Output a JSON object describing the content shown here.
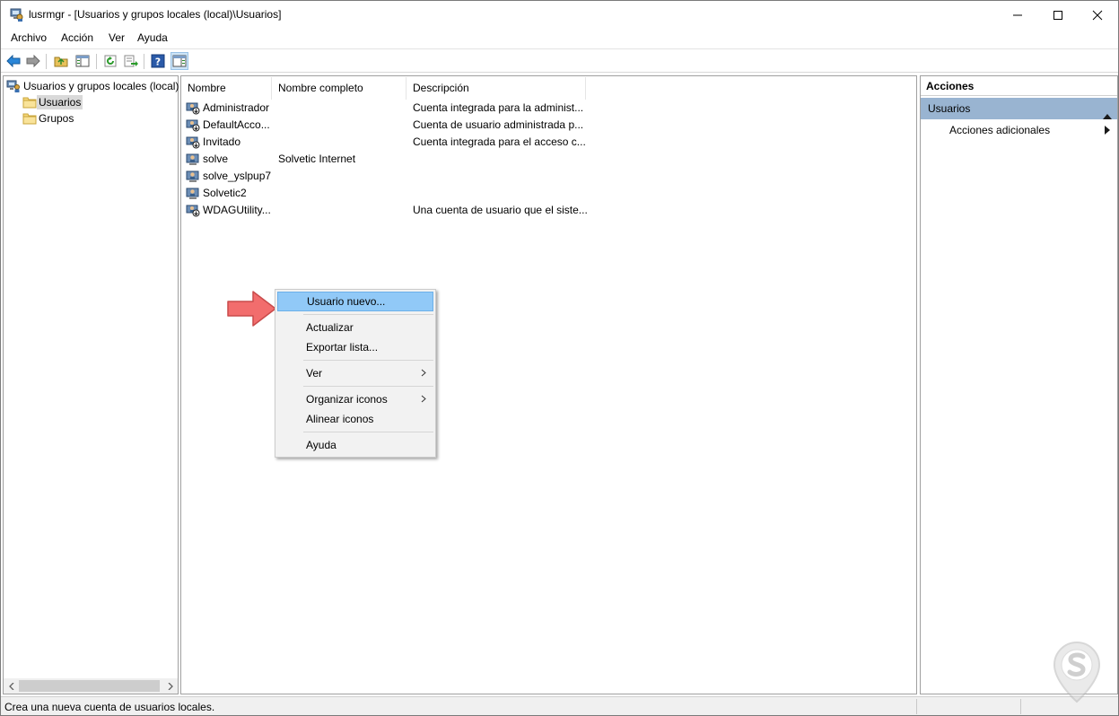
{
  "window": {
    "title": "lusrmgr - [Usuarios y grupos locales (local)\\Usuarios]",
    "controls": [
      "minimize",
      "maximize",
      "close"
    ]
  },
  "menubar": {
    "items": [
      "Archivo",
      "Acción",
      "Ver",
      "Ayuda"
    ]
  },
  "toolbar": {
    "buttons": [
      "back-icon",
      "forward-icon",
      "up-folder-icon",
      "show-hide-tree-icon",
      "refresh-icon",
      "export-list-icon",
      "help-icon",
      "show-hide-action-pane-icon"
    ]
  },
  "tree": {
    "root": "Usuarios y grupos locales (local)",
    "children": [
      {
        "label": "Usuarios",
        "selected": true
      },
      {
        "label": "Grupos",
        "selected": false
      }
    ]
  },
  "list": {
    "columns": [
      "Nombre",
      "Nombre completo",
      "Descripción"
    ],
    "rows": [
      {
        "name": "Administrador",
        "full_name": "",
        "description": "Cuenta integrada para la administ...",
        "disabled": true
      },
      {
        "name": "DefaultAcco...",
        "full_name": "",
        "description": "Cuenta de usuario administrada p...",
        "disabled": true
      },
      {
        "name": "Invitado",
        "full_name": "",
        "description": "Cuenta integrada para el acceso c...",
        "disabled": true
      },
      {
        "name": "solve",
        "full_name": "Solvetic Internet",
        "description": "",
        "disabled": false
      },
      {
        "name": "solve_yslpup7",
        "full_name": "",
        "description": "",
        "disabled": false
      },
      {
        "name": "Solvetic2",
        "full_name": "",
        "description": "",
        "disabled": false
      },
      {
        "name": "WDAGUtility...",
        "full_name": "",
        "description": "Una cuenta de usuario que el siste...",
        "disabled": true
      }
    ]
  },
  "context_menu": {
    "items": [
      {
        "label": "Usuario nuevo...",
        "highlighted": true,
        "submenu": false
      },
      {
        "label": "Actualizar",
        "highlighted": false,
        "submenu": false
      },
      {
        "label": "Exportar lista...",
        "highlighted": false,
        "submenu": false
      },
      {
        "label": "Ver",
        "highlighted": false,
        "submenu": true
      },
      {
        "label": "Organizar iconos",
        "highlighted": false,
        "submenu": true
      },
      {
        "label": "Alinear iconos",
        "highlighted": false,
        "submenu": false
      },
      {
        "label": "Ayuda",
        "highlighted": false,
        "submenu": false
      }
    ],
    "highlight_color": "#91c9f7"
  },
  "actions": {
    "title": "Acciones",
    "group": "Usuarios",
    "items": [
      "Acciones adicionales"
    ],
    "group_color": "#99b4d1"
  },
  "statusbar": {
    "text": "Crea una nueva cuenta de usuarios locales."
  },
  "annotation": {
    "arrow_color": "#f26d6d"
  }
}
